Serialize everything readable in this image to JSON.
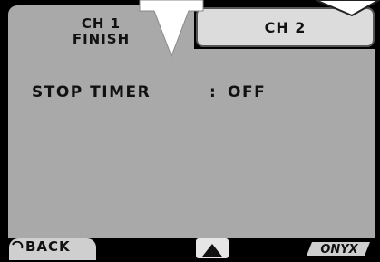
{
  "tabs": {
    "ch1_line1": "CH 1",
    "ch1_line2": "FINISH",
    "ch2": "CH 2"
  },
  "setting": {
    "label": "STOP TIMER",
    "separator": ":",
    "value": "OFF"
  },
  "footer": {
    "back_label": "BACK",
    "logo_text": "ONYX"
  },
  "colors": {
    "panel": "#a9a9a9",
    "active_tab": "#dcdcdc",
    "background": "#000000"
  }
}
